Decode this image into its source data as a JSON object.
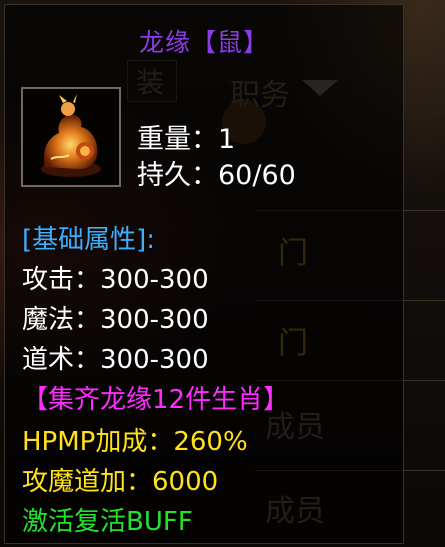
{
  "background": {
    "tab_label": "装",
    "job_label": "职务",
    "member_label_1": "成员",
    "member_label_2": "成员",
    "door_glyph_1": "门",
    "door_glyph_2": "门"
  },
  "tooltip": {
    "title": "龙缘【鼠】",
    "item_icon": "dragon-zodiac-rat-figurine-icon",
    "weight": "重量：1",
    "durability": "持久：60/60",
    "attributes_header": "[基础属性]:",
    "attack": "攻击：300-300",
    "magic": "魔法：300-300",
    "taoism": "道术：300-300",
    "set_header": "【集齐龙缘12件生肖】",
    "hpmp_bonus": "HPMP加成：260%",
    "attack_magic_tao_bonus": "攻魔道加：6000",
    "buff": "激活复活BUFF"
  },
  "colors": {
    "title": "#8a3de6",
    "attributes_header": "#3bb0ff",
    "set_header": "#ff2cff",
    "bonus": "#ffe21a",
    "buff": "#22e22c"
  }
}
